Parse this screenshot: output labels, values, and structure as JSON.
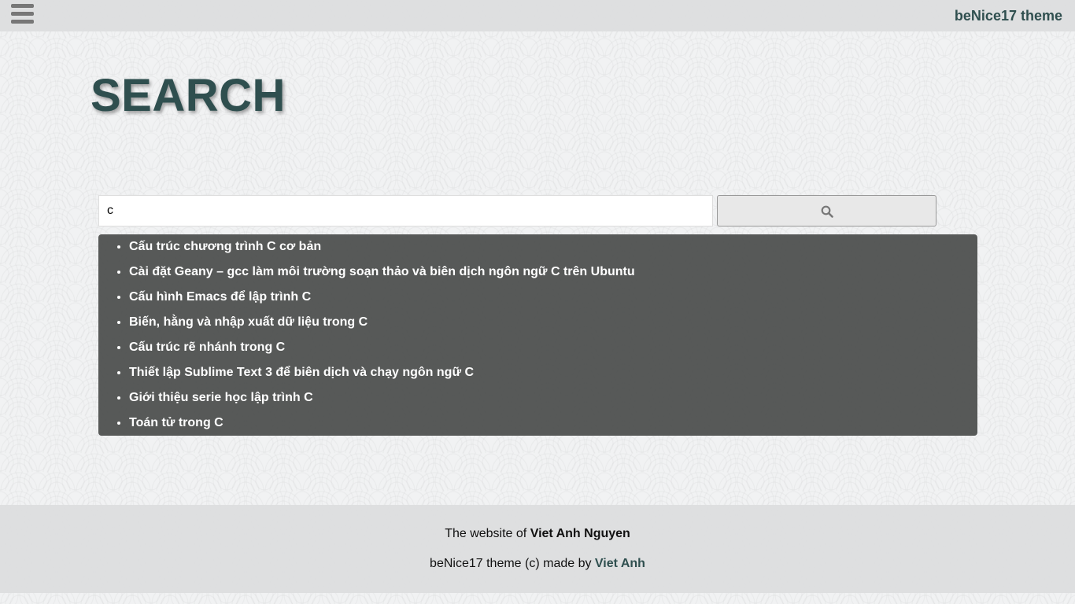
{
  "header": {
    "menu_icon": "hamburger-menu-icon",
    "brand": "beNice17 theme"
  },
  "main": {
    "title": "SEARCH",
    "search": {
      "value": "c",
      "button_icon": "search-icon"
    },
    "results": [
      "Cấu trúc chương trình C cơ bản",
      "Cài đặt Geany – gcc làm môi trường soạn thảo và biên dịch ngôn ngữ C trên Ubuntu",
      "Cấu hình Emacs để lập trình C",
      "Biến, hằng và nhập xuất dữ liệu trong C",
      "Cấu trúc rẽ nhánh trong C",
      "Thiết lập Sublime Text 3 để biên dịch và chạy ngôn ngữ C",
      "Giới thiệu serie học lập trình C",
      "Toán tử trong C"
    ]
  },
  "footer": {
    "line1_prefix": "The website of ",
    "line1_name": "Viet Anh Nguyen",
    "line2_prefix": "beNice17 theme (c) made by ",
    "line2_link": "Viet Anh"
  },
  "colors": {
    "accent": "#2f4f4f",
    "results_bg": "#505251",
    "bars": "#dcddde"
  }
}
